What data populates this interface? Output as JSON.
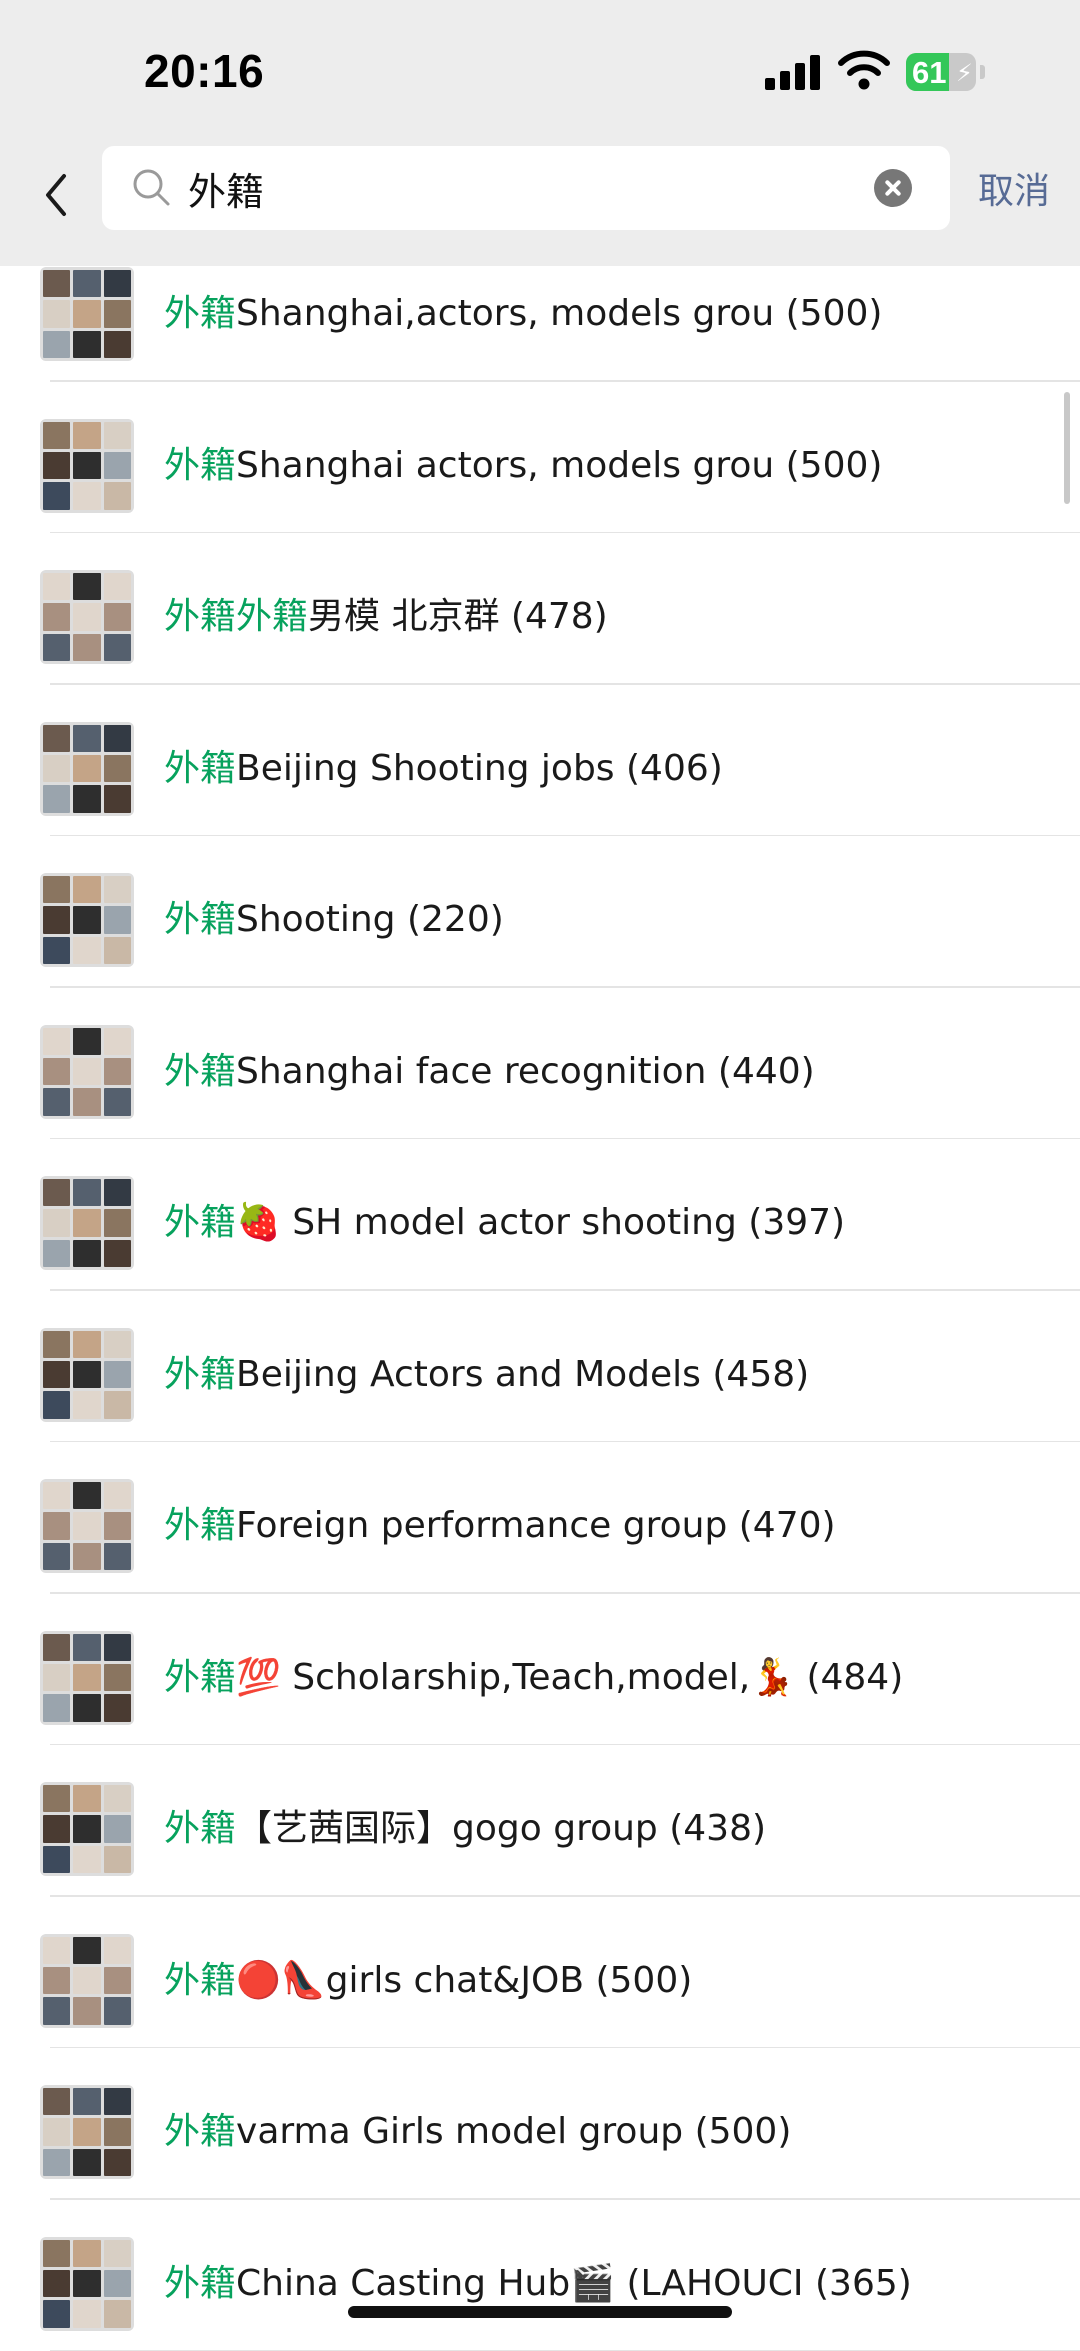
{
  "status_bar": {
    "time": "20:16",
    "battery_level": "61",
    "battery_fraction": 0.61,
    "charging": true
  },
  "search": {
    "query": "外籍",
    "cancel_label": "取消"
  },
  "icons": {
    "back": "chevron-left-icon",
    "search": "magnifier-icon",
    "clear": "clear-x-icon"
  },
  "colors": {
    "highlight": "#07a25d",
    "cancel": "#576b95",
    "chrome_bg": "#ededed",
    "battery_green": "#34c759"
  },
  "results": [
    {
      "highlight": "外籍",
      "title": "Shanghai,actors, models grou",
      "count": "(500)"
    },
    {
      "highlight": "外籍",
      "title": "Shanghai actors, models grou",
      "count": "(500)"
    },
    {
      "highlight": "外籍外籍",
      "title": "男模 北京群",
      "count": "(478)"
    },
    {
      "highlight": "外籍",
      "title": "Beijing Shooting jobs",
      "count": "(406)"
    },
    {
      "highlight": "外籍",
      "title": "Shooting",
      "count": "(220)"
    },
    {
      "highlight": "外籍",
      "title": "Shanghai face recognition",
      "count": "(440)"
    },
    {
      "highlight": "外籍",
      "title": "🍓 SH model actor shooting",
      "count": "(397)"
    },
    {
      "highlight": "外籍",
      "title": "Beijing Actors and Models",
      "count": "(458)"
    },
    {
      "highlight": "外籍",
      "title": "Foreign performance group",
      "count": "(470)"
    },
    {
      "highlight": "外籍",
      "title": "💯 Scholarship,Teach,model,💃",
      "count": "(484)"
    },
    {
      "highlight": "外籍",
      "title": "【艺茜国际】gogo group",
      "count": "(438)"
    },
    {
      "highlight": "外籍",
      "title": "🔴👠girls chat&JOB",
      "count": "(500)"
    },
    {
      "highlight": "外籍",
      "title": "varma  Girls model group",
      "count": "(500)"
    },
    {
      "highlight": "外籍",
      "title": "China Casting Hub🎬 (LAHOUCI",
      "count": "(365)"
    }
  ]
}
